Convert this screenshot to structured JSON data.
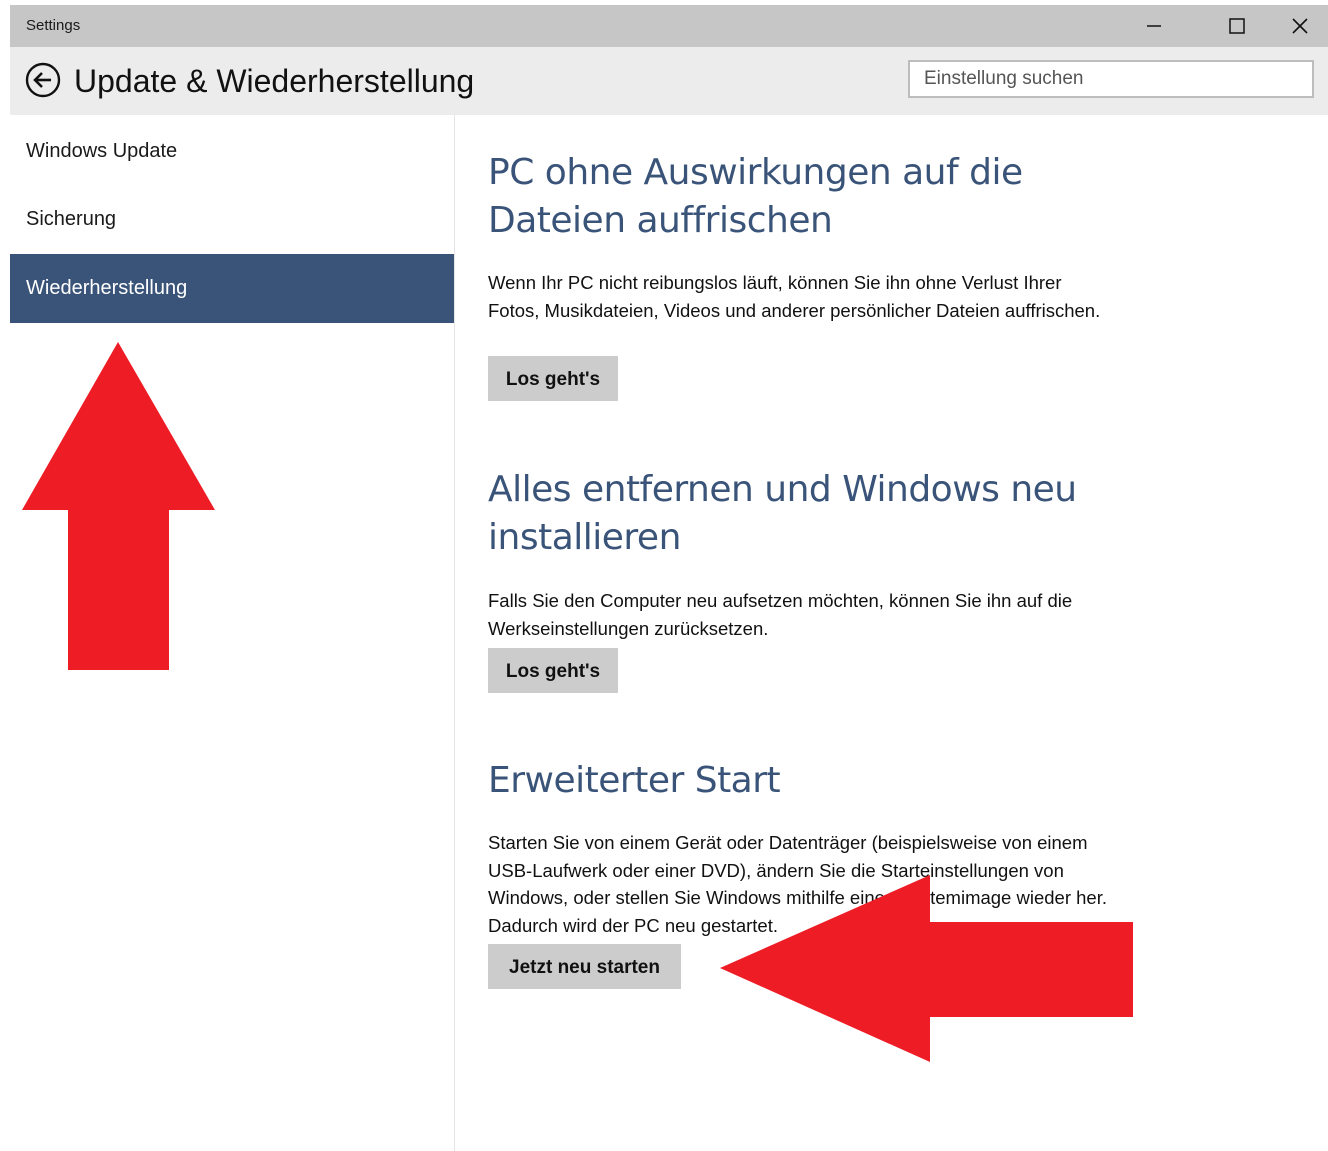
{
  "window": {
    "title": "Settings",
    "minimize_icon": "minimize-icon",
    "maximize_icon": "maximize-icon",
    "close_icon": "close-icon"
  },
  "header": {
    "back_icon": "back-arrow-icon",
    "title": "Update & Wiederherstellung",
    "search_placeholder": "Einstellung suchen"
  },
  "sidebar": {
    "items": [
      {
        "label": "Windows Update",
        "active": false
      },
      {
        "label": "Sicherung",
        "active": false
      },
      {
        "label": "Wiederherstellung",
        "active": true
      }
    ]
  },
  "main": {
    "sections": [
      {
        "title": "PC ohne Auswirkungen auf die Dateien auffrischen",
        "description": "Wenn Ihr PC nicht reibungslos läuft, können Sie ihn ohne Verlust Ihrer Fotos, Musikdateien, Videos und anderer persönlicher Dateien auffrischen.",
        "button": "Los geht's"
      },
      {
        "title": "Alles entfernen und Windows neu installieren",
        "description": "Falls Sie den Computer neu aufsetzen möchten, können Sie ihn auf die Werkseinstellungen zurücksetzen.",
        "button": "Los geht's"
      },
      {
        "title": "Erweiterter Start",
        "description": "Starten Sie von einem Gerät oder Datenträger (beispielsweise von einem USB-Laufwerk oder einer DVD), ändern Sie die Starteinstellungen von Windows, oder stellen Sie Windows mithilfe eines Systemimage wieder her. Dadurch wird der PC neu gestartet.",
        "button": "Jetzt neu starten"
      }
    ]
  },
  "colors": {
    "accent": "#3a5479",
    "titlebar": "#c6c6c6",
    "header": "#ececec",
    "button": "#cccccc",
    "annotation_arrow": "#ee1c25"
  },
  "annotations": {
    "arrow_up_icon": "red-arrow-up-icon",
    "arrow_left_icon": "red-arrow-left-icon"
  }
}
